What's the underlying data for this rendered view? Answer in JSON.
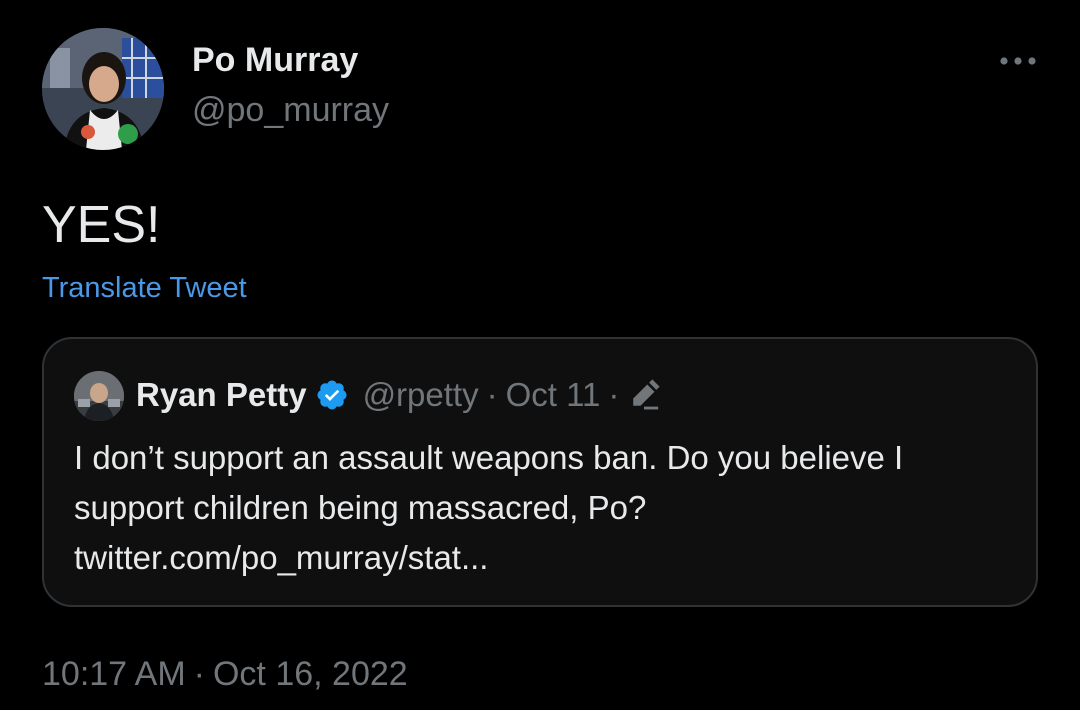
{
  "author": {
    "name": "Po Murray",
    "handle": "@po_murray"
  },
  "tweet": {
    "text": "YES!",
    "translate_label": "Translate Tweet",
    "time": "10:17 AM",
    "separator": "·",
    "date": "Oct 16, 2022"
  },
  "quoted_tweet": {
    "name": "Ryan Petty",
    "handle": "@rpetty",
    "separator": "·",
    "date": "Oct 11",
    "text_line1": "I don’t support an assault weapons ban. Do you believe I support children being massacred, Po?",
    "link": "twitter.com/po_murray/stat..."
  },
  "colors": {
    "background": "#000000",
    "text": "#e7e9ea",
    "secondary": "#71767b",
    "link": "#4a99e9",
    "verified": "#1d9bf0"
  },
  "icons": {
    "more": "more-horizontal-icon",
    "verified": "verified-badge-icon",
    "edit": "edit-pencil-icon"
  }
}
